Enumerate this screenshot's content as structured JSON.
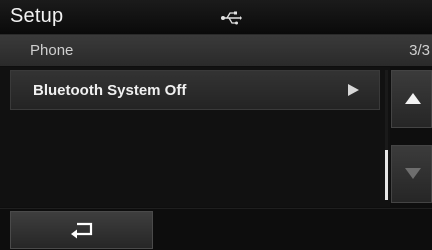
{
  "header": {
    "title": "Setup",
    "status_icon": "usb-icon"
  },
  "subheader": {
    "label": "Phone",
    "page_counter": "3/3"
  },
  "list": {
    "items": [
      {
        "label": "Bluetooth System Off",
        "icon": "play-icon"
      }
    ]
  },
  "scroll": {
    "up_icon": "triangle-up-icon",
    "down_icon": "triangle-down-icon"
  },
  "footer": {
    "back_icon": "return-arrow-icon"
  },
  "colors": {
    "background": "#0e0e0e",
    "text": "#f0f0f0",
    "button": "#2e2e2e"
  }
}
